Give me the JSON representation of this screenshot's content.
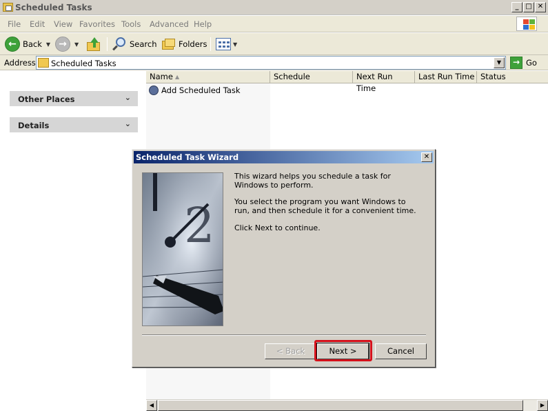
{
  "window": {
    "title": "Scheduled Tasks",
    "min_glyph": "_",
    "max_glyph": "□",
    "close_glyph": "✕"
  },
  "menu": [
    "File",
    "Edit",
    "View",
    "Favorites",
    "Tools",
    "Advanced",
    "Help"
  ],
  "toolbar": {
    "back_label": "Back",
    "search_label": "Search",
    "folders_label": "Folders"
  },
  "address": {
    "label": "Address",
    "value": "Scheduled Tasks",
    "go_label": "Go"
  },
  "left_panels": [
    {
      "label": "Other Places"
    },
    {
      "label": "Details"
    }
  ],
  "list": {
    "columns": [
      "Name",
      "Schedule",
      "Next Run Time",
      "Last Run Time",
      "Status"
    ],
    "rows": [
      {
        "name": "Add Scheduled Task"
      }
    ]
  },
  "dialog": {
    "title": "Scheduled Task Wizard",
    "paragraphs": [
      "This wizard helps you schedule a task for Windows to perform.",
      "You select the program you want Windows to run, and then schedule it for a convenient time.",
      "Click Next to continue."
    ],
    "back_label": "< Back",
    "next_label": "Next >",
    "cancel_label": "Cancel",
    "back_enabled": false,
    "next_highlighted": true
  },
  "colors": {
    "titlebar_gradient_start": "#0a246a",
    "titlebar_gradient_end": "#a6caf0",
    "highlight": "#d4111b"
  }
}
